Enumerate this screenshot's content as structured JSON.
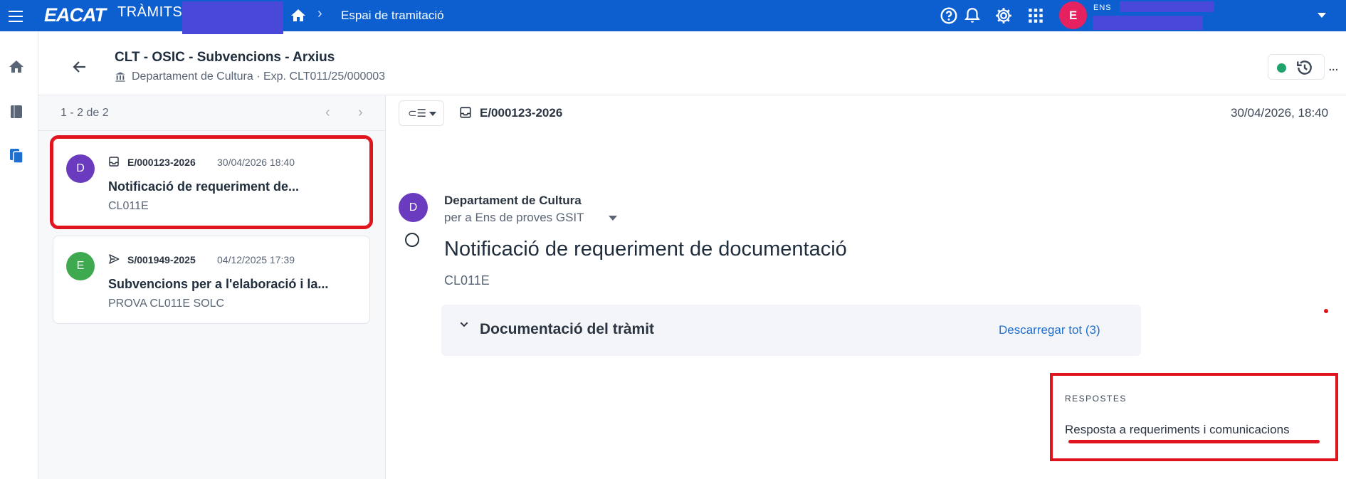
{
  "topbar": {
    "logo": "EACAT",
    "logo_sub": "TRÀMITS",
    "breadcrumb": "Espai de tramitació",
    "avatar_initial": "E",
    "user_label": "ENS",
    "icons": [
      "menu-icon",
      "home-icon",
      "help-icon",
      "bell-icon",
      "gear-icon",
      "apps-grid-icon",
      "chevron-down-icon"
    ],
    "color": "#0d5fd0"
  },
  "rail": {
    "icons": [
      "home-icon",
      "book-icon",
      "documents-icon"
    ]
  },
  "header": {
    "title": "CLT - OSIC - Subvencions - Arxius",
    "subtitle": "Departament de Cultura · Exp. CLT011/25/000003",
    "status_color": "#1fa36a",
    "more": "..."
  },
  "list": {
    "pager": "1 - 2 de 2",
    "prev": "‹",
    "next": "›",
    "items": [
      {
        "avatar": "D",
        "avatar_color": "#6a3bbf",
        "icon": "inbox-icon",
        "ref": "E/000123-2026",
        "date": "30/04/2026 18:40",
        "subject": "Notificació de requeriment de...",
        "code": "CL011E",
        "selected": true
      },
      {
        "avatar": "E",
        "avatar_color": "#3ea94f",
        "icon": "send-icon",
        "ref": "S/001949-2025",
        "date": "04/12/2025 17:39",
        "subject": "Subvencions per a l'elaboració i la...",
        "code": "PROVA CL011E SOLC",
        "selected": false
      }
    ]
  },
  "detail": {
    "ref": "E/000123-2026",
    "date": "30/04/2026, 18:40",
    "message": {
      "avatar": "D",
      "from": "Departament de Cultura",
      "to": "per a Ens de proves GSIT",
      "title": "Notificació de requeriment de documentació",
      "code": "CL011E"
    },
    "docs": {
      "label": "Documentació del tràmit",
      "download": "Descarregar tot (3)"
    },
    "responses": {
      "heading": "RESPOSTES",
      "link": "Resposta a requeriments i comunicacions"
    }
  },
  "accent_red": "#e0141c"
}
